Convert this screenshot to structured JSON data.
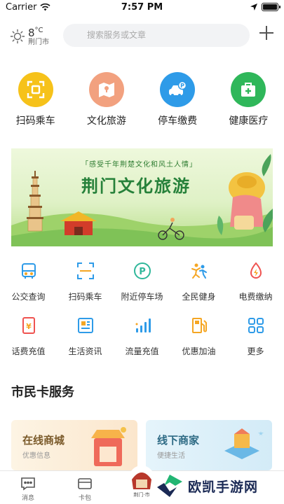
{
  "status_bar": {
    "carrier": "Carrier",
    "time": "7:57 PM"
  },
  "header": {
    "temperature": "8",
    "temp_unit": "°C",
    "city": "荆门市",
    "search_placeholder": "搜索服务或文章"
  },
  "top_services": [
    {
      "label": "扫码乘车",
      "icon": "scan-icon",
      "color": "#f6c21a"
    },
    {
      "label": "文化旅游",
      "icon": "map-icon",
      "color": "#f2a17f"
    },
    {
      "label": "停车缴费",
      "icon": "car-parking-icon",
      "color": "#2e9be8"
    },
    {
      "label": "健康医疗",
      "icon": "medical-kit-icon",
      "color": "#2fb75a"
    }
  ],
  "banner": {
    "tagline": "「感受千年荆楚文化和风土人情」",
    "headline": "荆门文化旅游"
  },
  "services": [
    [
      {
        "label": "公交查询",
        "icon": "bus-icon"
      },
      {
        "label": "扫码乘车",
        "icon": "scan-icon"
      },
      {
        "label": "附近停车场",
        "icon": "parking-icon"
      },
      {
        "label": "全民健身",
        "icon": "fitness-icon"
      },
      {
        "label": "电费缴纳",
        "icon": "flame-icon"
      }
    ],
    [
      {
        "label": "话费充值",
        "icon": "phone-bill-icon"
      },
      {
        "label": "生活资讯",
        "icon": "news-icon"
      },
      {
        "label": "流量充值",
        "icon": "signal-icon"
      },
      {
        "label": "优惠加油",
        "icon": "fuel-icon"
      },
      {
        "label": "更多",
        "icon": "grid-icon"
      }
    ]
  ],
  "section": {
    "title": "市民卡服务",
    "cards": [
      {
        "title": "在线商城",
        "subtitle": "优惠信息"
      },
      {
        "title": "线下商家",
        "subtitle": "便捷生活"
      }
    ]
  },
  "tabbar": {
    "tabs": [
      {
        "label": "消息",
        "icon": "message-icon"
      },
      {
        "label": "卡包",
        "icon": "wallet-icon"
      }
    ],
    "center_label": "荆门·市"
  },
  "watermark": {
    "text": "欧凯手游网"
  },
  "colors": {
    "accent_green": "#26813a",
    "icon_blue": "#2e9be8",
    "icon_orange": "#f5a623"
  }
}
